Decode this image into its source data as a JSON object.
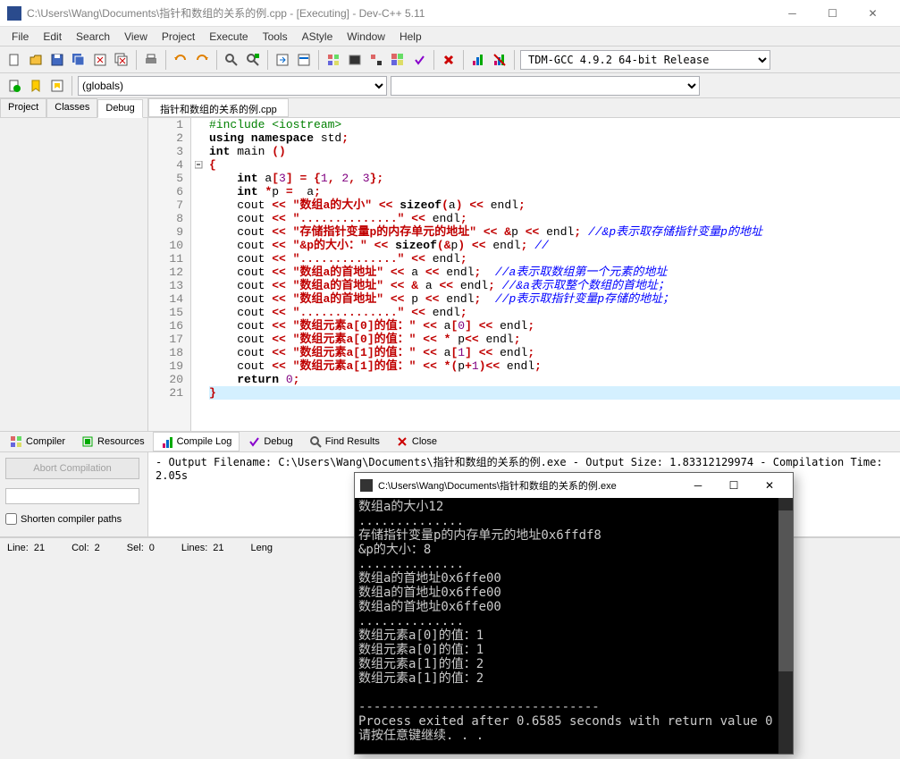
{
  "title": "C:\\Users\\Wang\\Documents\\指针和数组的关系的例.cpp - [Executing] - Dev-C++ 5.11",
  "menu": [
    "File",
    "Edit",
    "Search",
    "View",
    "Project",
    "Execute",
    "Tools",
    "AStyle",
    "Window",
    "Help"
  ],
  "compiler_select": "TDM-GCC 4.9.2 64-bit Release",
  "scope_select": "(globals)",
  "side_tabs": [
    "Project",
    "Classes",
    "Debug"
  ],
  "file_tab": "指针和数组的关系的例.cpp",
  "code": [
    {
      "n": 1,
      "t": "#include <iostream>",
      "cls": "pp"
    },
    {
      "n": 2,
      "raw": "<span class='kw'>using namespace</span> std<span class='op'>;</span>"
    },
    {
      "n": 3,
      "raw": "<span class='kw'>int</span> main <span class='op'>()</span>"
    },
    {
      "n": 4,
      "raw": "<span class='br'>{</span>",
      "fold": true
    },
    {
      "n": 5,
      "raw": "    <span class='kw'>int</span> a<span class='op'>[</span><span class='nm'>3</span><span class='op'>] = {</span><span class='nm'>1</span><span class='op'>,</span> <span class='nm'>2</span><span class='op'>,</span> <span class='nm'>3</span><span class='op'>};</span>"
    },
    {
      "n": 6,
      "raw": "    <span class='kw'>int</span> <span class='op'>*</span>p <span class='op'>=</span>  a<span class='op'>;</span>"
    },
    {
      "n": 7,
      "raw": "    cout <span class='op'>&lt;&lt;</span> <span class='st'>\"数组a的大小\"</span> <span class='op'>&lt;&lt;</span> <span class='kw'>sizeof</span><span class='op'>(</span>a<span class='op'>) &lt;&lt;</span> endl<span class='op'>;</span>"
    },
    {
      "n": 8,
      "raw": "    cout <span class='op'>&lt;&lt;</span> <span class='st'>\"..............\"</span> <span class='op'>&lt;&lt;</span> endl<span class='op'>;</span>"
    },
    {
      "n": 9,
      "raw": "    cout <span class='op'>&lt;&lt;</span> <span class='st'>\"存储指针变量p的内存单元的地址\"</span> <span class='op'>&lt;&lt; &amp;</span>p <span class='op'>&lt;&lt;</span> endl<span class='op'>;</span> <span class='cm'>//&amp;p表示取存储指针变量p的地址</span>"
    },
    {
      "n": 10,
      "raw": "    cout <span class='op'>&lt;&lt;</span> <span class='st'>\"&amp;p的大小：\"</span> <span class='op'>&lt;&lt;</span> <span class='kw'>sizeof</span><span class='op'>(&amp;</span>p<span class='op'>) &lt;&lt;</span> endl<span class='op'>;</span> <span class='cm'>//</span>"
    },
    {
      "n": 11,
      "raw": "    cout <span class='op'>&lt;&lt;</span> <span class='st'>\"..............\"</span> <span class='op'>&lt;&lt;</span> endl<span class='op'>;</span>"
    },
    {
      "n": 12,
      "raw": "    cout <span class='op'>&lt;&lt;</span> <span class='st'>\"数组a的首地址\"</span> <span class='op'>&lt;&lt;</span> a <span class='op'>&lt;&lt;</span> endl<span class='op'>;</span>  <span class='cm'>//a表示取数组第一个元素的地址</span>"
    },
    {
      "n": 13,
      "raw": "    cout <span class='op'>&lt;&lt;</span> <span class='st'>\"数组a的首地址\"</span> <span class='op'>&lt;&lt; &amp;</span> a <span class='op'>&lt;&lt;</span> endl<span class='op'>;</span> <span class='cm'>//&amp;a表示取整个数组的首地址；</span>"
    },
    {
      "n": 14,
      "raw": "    cout <span class='op'>&lt;&lt;</span> <span class='st'>\"数组a的首地址\"</span> <span class='op'>&lt;&lt;</span> p <span class='op'>&lt;&lt;</span> endl<span class='op'>;</span>  <span class='cm'>//p表示取指针变量p存储的地址；</span>"
    },
    {
      "n": 15,
      "raw": "    cout <span class='op'>&lt;&lt;</span> <span class='st'>\"..............\"</span> <span class='op'>&lt;&lt;</span> endl<span class='op'>;</span>"
    },
    {
      "n": 16,
      "raw": "    cout <span class='op'>&lt;&lt;</span> <span class='st'>\"数组元素a[0]的值：\"</span> <span class='op'>&lt;&lt;</span> a<span class='op'>[</span><span class='nm'>0</span><span class='op'>] &lt;&lt;</span> endl<span class='op'>;</span>"
    },
    {
      "n": 17,
      "raw": "    cout <span class='op'>&lt;&lt;</span> <span class='st'>\"数组元素a[0]的值：\"</span> <span class='op'>&lt;&lt; *</span> p<span class='op'>&lt;&lt;</span> endl<span class='op'>;</span>"
    },
    {
      "n": 18,
      "raw": "    cout <span class='op'>&lt;&lt;</span> <span class='st'>\"数组元素a[1]的值：\"</span> <span class='op'>&lt;&lt;</span> a<span class='op'>[</span><span class='nm'>1</span><span class='op'>] &lt;&lt;</span> endl<span class='op'>;</span>"
    },
    {
      "n": 19,
      "raw": "    cout <span class='op'>&lt;&lt;</span> <span class='st'>\"数组元素a[1]的值：\"</span> <span class='op'>&lt;&lt; *(</span>p<span class='op'>+</span><span class='nm'>1</span><span class='op'>)&lt;&lt;</span> endl<span class='op'>;</span>"
    },
    {
      "n": 20,
      "raw": "    <span class='kw'>return</span> <span class='nm'>0</span><span class='op'>;</span>"
    },
    {
      "n": 21,
      "raw": "<span class='br'>}</span>",
      "hl": true
    }
  ],
  "bottom_tabs": [
    "Compiler",
    "Resources",
    "Compile Log",
    "Debug",
    "Find Results",
    "Close"
  ],
  "abort_label": "Abort Compilation",
  "shorten_label": "Shorten compiler paths",
  "compile_log": [
    "- Output Filename: C:\\Users\\Wang\\Documents\\指针和数组的关系的例.exe",
    "- Output Size: 1.83312129974",
    "- Compilation Time: 2.05s"
  ],
  "status": {
    "line_lbl": "Line:",
    "line": "21",
    "col_lbl": "Col:",
    "col": "2",
    "sel_lbl": "Sel:",
    "sel": "0",
    "lines_lbl": "Lines:",
    "lines": "21",
    "len_lbl": "Leng"
  },
  "console": {
    "title": "C:\\Users\\Wang\\Documents\\指针和数组的关系的例.exe",
    "lines": [
      "数组a的大小12",
      "..............",
      "存储指针变量p的内存单元的地址0x6ffdf8",
      "&p的大小：8",
      "..............",
      "数组a的首地址0x6ffe00",
      "数组a的首地址0x6ffe00",
      "数组a的首地址0x6ffe00",
      "..............",
      "数组元素a[0]的值：1",
      "数组元素a[0]的值：1",
      "数组元素a[1]的值：2",
      "数组元素a[1]的值：2",
      "",
      "--------------------------------",
      "Process exited after 0.6585 seconds with return value 0",
      "请按任意键继续. . ."
    ]
  }
}
